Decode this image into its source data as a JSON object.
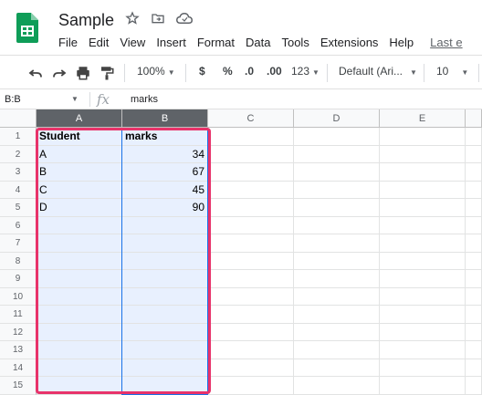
{
  "document": {
    "title": "Sample",
    "icons": [
      "star-icon",
      "move-to-folder-icon",
      "cloud-status-icon"
    ]
  },
  "menu": [
    "File",
    "Edit",
    "View",
    "Insert",
    "Format",
    "Data",
    "Tools",
    "Extensions",
    "Help"
  ],
  "last_edit_label": "Last e",
  "toolbar": {
    "zoom": "100%",
    "currency": "$",
    "percent": "%",
    "decrease_decimal": ".0",
    "increase_decimal": ".00",
    "more_formats": "123",
    "font_family": "Default (Ari...",
    "font_size": "10"
  },
  "formula_bar": {
    "name_box": "B:B",
    "fx_label": "fx",
    "value": "marks"
  },
  "columns": [
    "A",
    "B",
    "C",
    "D",
    "E"
  ],
  "rows": [
    "1",
    "2",
    "3",
    "4",
    "5",
    "6",
    "7",
    "8",
    "9",
    "10",
    "11",
    "12",
    "13",
    "14",
    "15"
  ],
  "cells": {
    "A1": "Student",
    "B1": "marks",
    "A2": "A",
    "B2": "34",
    "A3": "B",
    "B3": "67",
    "A4": "C",
    "B4": "45",
    "A5": "D",
    "B5": "90"
  },
  "colors": {
    "brand_green": "#0f9d58",
    "selection_fill": "#e8f0fe",
    "selection_border": "#1a73e8",
    "highlight": "#e8336a"
  }
}
